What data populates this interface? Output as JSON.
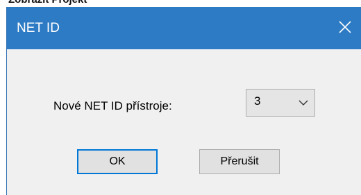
{
  "background_window": {
    "title_fragment": "Zobrazit Projekt"
  },
  "dialog": {
    "title": "NET ID",
    "close_icon": "close-icon",
    "field_label": "Nové NET ID přístroje:",
    "select": {
      "value": "3",
      "arrow_icon": "chevron-down-icon"
    },
    "ok_label": "OK",
    "cancel_label": "Přerušit"
  },
  "colors": {
    "titlebar": "#2d7bc4",
    "dialog_bg": "#f0f0f0",
    "default_button_border": "#0078d7"
  }
}
